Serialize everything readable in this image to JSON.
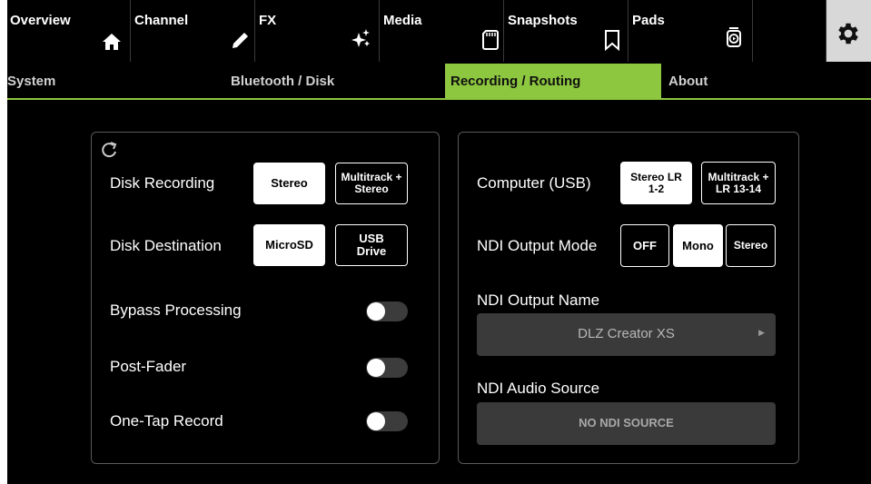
{
  "topnav": {
    "tabs": [
      {
        "label": "Overview",
        "icon": "home-icon"
      },
      {
        "label": "Channel",
        "icon": "pencil-icon"
      },
      {
        "label": "FX",
        "icon": "sparkle-icon"
      },
      {
        "label": "Media",
        "icon": "sd-card-icon"
      },
      {
        "label": "Snapshots",
        "icon": "bookmark-icon"
      },
      {
        "label": "Pads",
        "icon": "pads-icon"
      }
    ],
    "settings_icon": "gear-icon"
  },
  "subnav": {
    "tabs": [
      {
        "label": "System"
      },
      {
        "label": "Bluetooth / Disk"
      },
      {
        "label": "Recording / Routing",
        "active": true
      },
      {
        "label": "About"
      }
    ],
    "accent": "#8dc63f"
  },
  "left_panel": {
    "refresh_icon": "refresh-icon",
    "disk_recording": {
      "label": "Disk Recording",
      "options": [
        "Stereo",
        "Multitrack + Stereo"
      ],
      "selected": "Stereo"
    },
    "disk_destination": {
      "label": "Disk Destination",
      "options": [
        "MicroSD",
        "USB Drive"
      ],
      "selected": "MicroSD"
    },
    "bypass_processing": {
      "label": "Bypass Processing",
      "on": false
    },
    "post_fader": {
      "label": "Post-Fader",
      "on": false
    },
    "one_tap_record": {
      "label": "One-Tap Record",
      "on": false
    }
  },
  "right_panel": {
    "computer_usb": {
      "label": "Computer (USB)",
      "options": [
        "Stereo LR 1-2",
        "Multitrack + LR 13-14"
      ],
      "selected": "Stereo LR 1-2"
    },
    "ndi_output_mode": {
      "label": "NDI Output Mode",
      "options": [
        "OFF",
        "Mono",
        "Stereo"
      ],
      "selected": "Mono"
    },
    "ndi_output_name": {
      "label": "NDI Output Name",
      "value": "DLZ Creator XS"
    },
    "ndi_audio_source": {
      "label": "NDI Audio Source",
      "value": "NO NDI SOURCE"
    }
  }
}
